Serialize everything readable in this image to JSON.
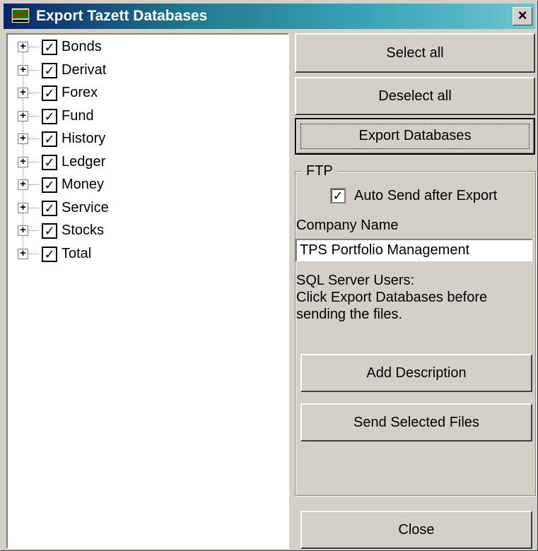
{
  "window": {
    "title": "Export Tazett Databases",
    "close_label": "×"
  },
  "tree": {
    "items": [
      {
        "label": "Bonds",
        "checked": true
      },
      {
        "label": "Derivat",
        "checked": true
      },
      {
        "label": "Forex",
        "checked": true
      },
      {
        "label": "Fund",
        "checked": true
      },
      {
        "label": "History",
        "checked": true
      },
      {
        "label": "Ledger",
        "checked": true
      },
      {
        "label": "Money",
        "checked": true
      },
      {
        "label": "Service",
        "checked": true
      },
      {
        "label": "Stocks",
        "checked": true
      },
      {
        "label": "Total",
        "checked": true
      }
    ],
    "expand_glyph": "+",
    "check_glyph": "✓"
  },
  "buttons": {
    "select_all": "Select all",
    "deselect_all": "Deselect all",
    "export_databases": "Export Databases",
    "add_description": "Add Description",
    "send_selected_files": "Send Selected Files",
    "close": "Close"
  },
  "ftp": {
    "legend": "FTP",
    "auto_send_label": "Auto Send after Export",
    "auto_send_checked": true,
    "company_name_label": "Company Name",
    "company_name_value": "TPS Portfolio Management",
    "note_line1": "SQL Server Users:",
    "note_line2": "Click Export Databases before",
    "note_line3": "sending the files."
  },
  "colors": {
    "titlebar_start": "#0a246a",
    "titlebar_end": "#6cc5d0",
    "face": "#d4d0c8"
  }
}
